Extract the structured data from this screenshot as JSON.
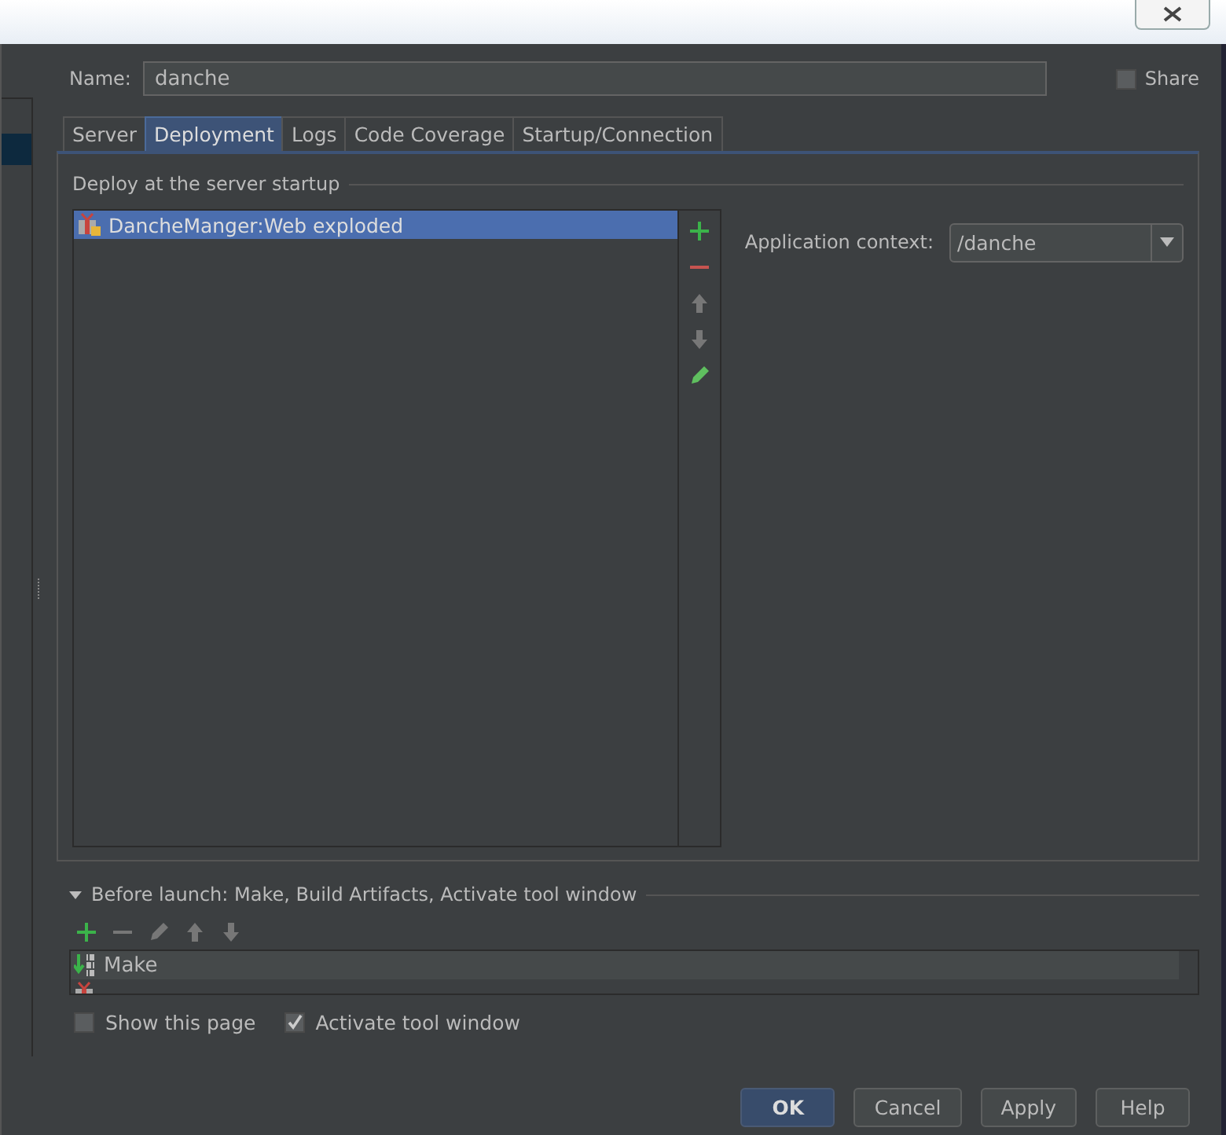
{
  "name_field": {
    "label": "Name:",
    "value": "danche"
  },
  "share": {
    "label": "Share",
    "checked": false
  },
  "tabs": [
    {
      "label": "Server",
      "selected": false
    },
    {
      "label": "Deployment",
      "selected": true
    },
    {
      "label": "Logs",
      "selected": false
    },
    {
      "label": "Code Coverage",
      "selected": false
    },
    {
      "label": "Startup/Connection",
      "selected": false
    }
  ],
  "deploy_section": {
    "title": "Deploy at the server startup",
    "items": [
      {
        "label": "DancheManger:Web exploded",
        "selected": true
      }
    ],
    "app_context": {
      "label": "Application context:",
      "value": "/danche"
    }
  },
  "before_launch": {
    "title": "Before launch: Make, Build Artifacts, Activate tool window",
    "expanded": true,
    "tasks": [
      {
        "kind": "make",
        "label": "Make",
        "selected": true
      },
      {
        "kind": "artifact",
        "selected": false
      }
    ]
  },
  "options": [
    {
      "label": "Show this page",
      "checked": false
    },
    {
      "label": "Activate tool window",
      "checked": true
    }
  ],
  "buttons": [
    {
      "label": "OK",
      "kind": "default"
    },
    {
      "label": "Cancel",
      "kind": "normal"
    },
    {
      "label": "Apply",
      "kind": "normal"
    },
    {
      "label": "Help",
      "kind": "normal"
    }
  ]
}
